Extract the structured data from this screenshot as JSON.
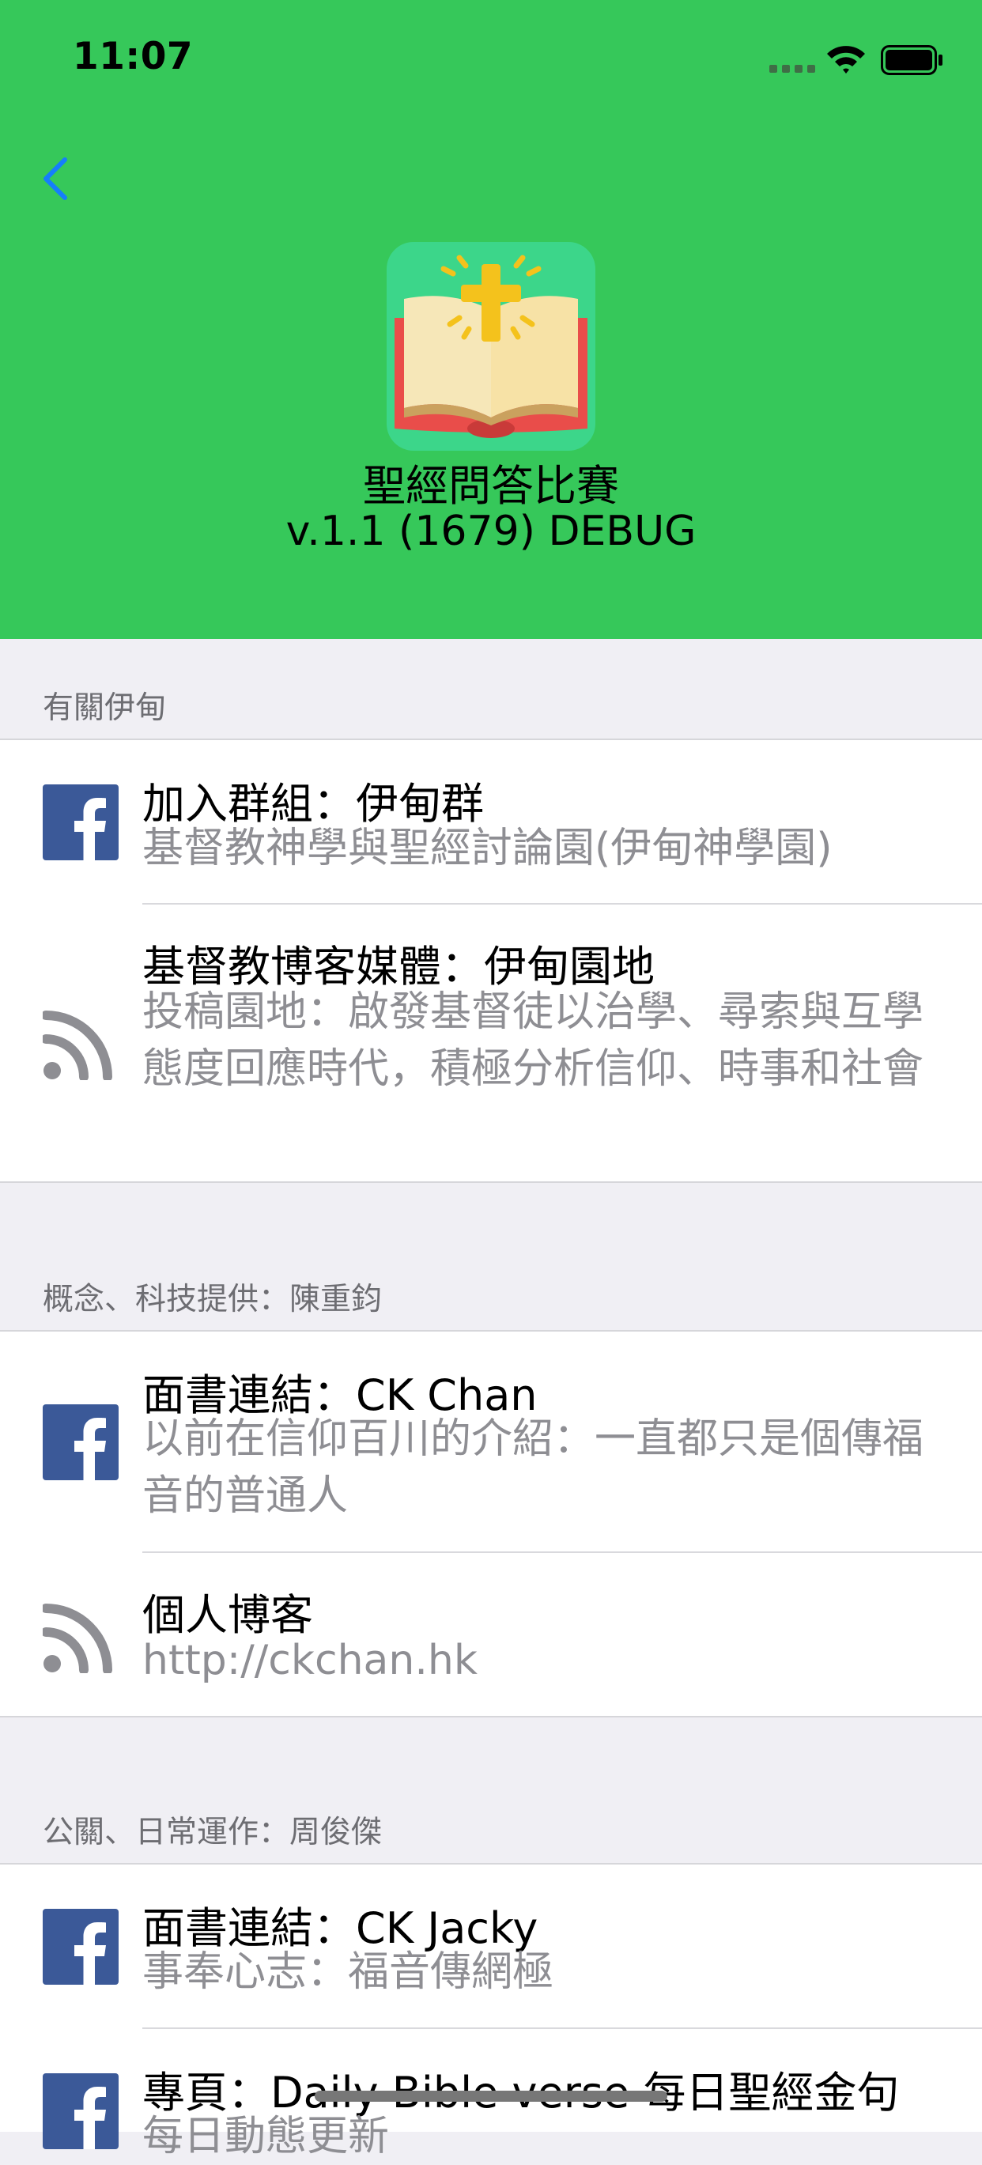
{
  "status_bar": {
    "time": "11:07"
  },
  "app": {
    "name": "聖經問答比賽",
    "version": "v.1.1 (1679) DEBUG",
    "brand_color": "#36c85a"
  },
  "sections": [
    {
      "title": "有關伊甸",
      "rows": [
        {
          "icon": "facebook-icon",
          "title": "加入群組：伊甸群",
          "subtitle": "基督教神學與聖經討論園(伊甸神學園)"
        },
        {
          "icon": "rss-icon",
          "title": "基督教博客媒體：伊甸園地",
          "subtitle": "投稿園地：啟發基督徒以治學、尋索與互學態度回應時代，積極分析信仰、時事和社會"
        }
      ]
    },
    {
      "title": "概念、科技提供：陳重鈞",
      "rows": [
        {
          "icon": "facebook-icon",
          "title": "面書連結：CK Chan",
          "subtitle": "以前在信仰百川的介紹：一直都只是個傳福音的普通人"
        },
        {
          "icon": "rss-icon",
          "title": "個人博客",
          "subtitle": "http://ckchan.hk"
        }
      ]
    },
    {
      "title": "公關、日常運作：周俊傑",
      "rows": [
        {
          "icon": "facebook-icon",
          "title": "面書連結：CK Jacky",
          "subtitle": "事奉心志：福音傳網極"
        },
        {
          "icon": "facebook-icon",
          "title": "專頁：Daily Bible verse 每日聖經金句",
          "subtitle": "每日動態更新"
        }
      ]
    }
  ]
}
